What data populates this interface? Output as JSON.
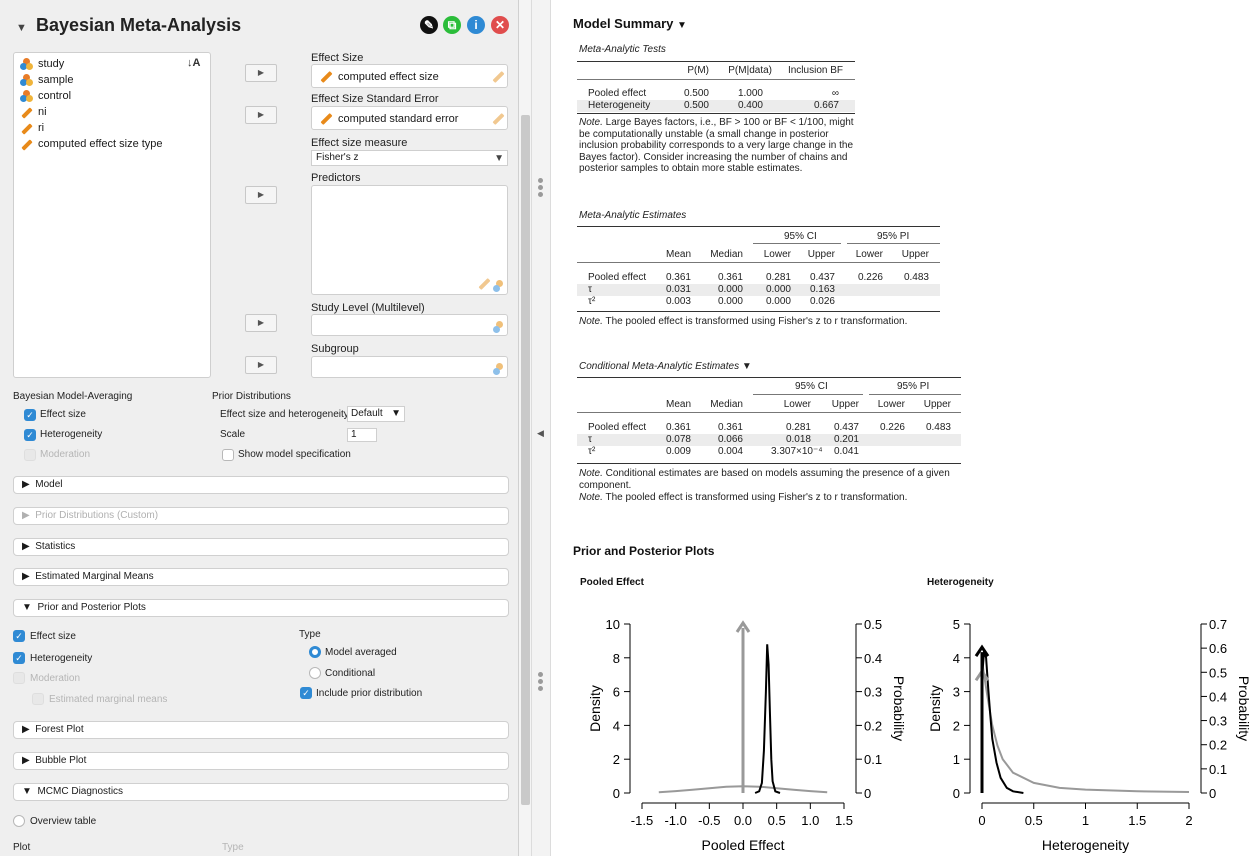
{
  "panel": {
    "title": "Bayesian Meta-Analysis",
    "sort_icon": "sort-az-icon",
    "variables": [
      {
        "name": "study",
        "type": "nominal"
      },
      {
        "name": "sample",
        "type": "nominal"
      },
      {
        "name": "control",
        "type": "nominal"
      },
      {
        "name": "ni",
        "type": "scale"
      },
      {
        "name": "ri",
        "type": "scale"
      },
      {
        "name": "computed effect size type",
        "type": "scale"
      }
    ],
    "effect_size_label": "Effect Size",
    "effect_size_value": "computed effect size",
    "se_label": "Effect Size Standard Error",
    "se_value": "computed standard error",
    "measure_label": "Effect size measure",
    "measure_value": "Fisher's z",
    "predictors_label": "Predictors",
    "study_level_label": "Study Level (Multilevel)",
    "subgroup_label": "Subgroup",
    "bma_label": "Bayesian Model-Averaging",
    "bma_effect_size": "Effect size",
    "bma_heterogeneity": "Heterogeneity",
    "bma_moderation": "Moderation",
    "prior_label": "Prior Distributions",
    "prior_eh_label": "Effect size and heterogeneity",
    "prior_eh_value": "Default",
    "scale_label": "Scale",
    "scale_value": "1",
    "show_model_spec": "Show model specification",
    "sections": [
      "Model",
      "Prior Distributions (Custom)",
      "Statistics",
      "Estimated Marginal Means",
      "Prior and Posterior Plots"
    ],
    "pp_effect_size": "Effect size",
    "pp_heterogeneity": "Heterogeneity",
    "pp_moderation": "Moderation",
    "pp_emm": "Estimated marginal means",
    "type_label": "Type",
    "type_model_averaged": "Model averaged",
    "type_conditional": "Conditional",
    "include_prior": "Include prior distribution",
    "sections2": [
      "Forest Plot",
      "Bubble Plot",
      "MCMC Diagnostics"
    ],
    "overview_table": "Overview table",
    "plot_col": "Plot",
    "type_col": "Type"
  },
  "output": {
    "model_summary": "Model Summary",
    "tests": {
      "title": "Meta-Analytic Tests",
      "headers": [
        "P(M)",
        "P(M|data)",
        "Inclusion BF"
      ],
      "rows": [
        {
          "label": "Pooled effect",
          "pm": "0.500",
          "pmd": "1.000",
          "bf": "∞"
        },
        {
          "label": "Heterogeneity",
          "pm": "0.500",
          "pmd": "0.400",
          "bf": "0.667"
        }
      ],
      "note_prefix": "Note.",
      "note": " Large Bayes factors, i.e., BF > 100 or BF < 1/100, might be computationally unstable (a small change in posterior inclusion probability corresponds to a very large change in the Bayes factor). Consider increasing the number of chains and posterior samples to obtain more stable estimates."
    },
    "estimates": {
      "title": "Meta-Analytic Estimates",
      "ci": "95% CI",
      "pi": "95% PI",
      "headers": [
        "Mean",
        "Median",
        "Lower",
        "Upper",
        "Lower",
        "Upper"
      ],
      "rows": [
        {
          "label": "Pooled effect",
          "cells": [
            "0.361",
            "0.361",
            "0.281",
            "0.437",
            "0.226",
            "0.483"
          ]
        },
        {
          "label": "τ",
          "cells": [
            "0.031",
            "0.000",
            "0.000",
            "0.163",
            "",
            ""
          ]
        },
        {
          "label": "τ²",
          "cells": [
            "0.003",
            "0.000",
            "0.000",
            "0.026",
            "",
            ""
          ]
        }
      ],
      "note_prefix": "Note.",
      "note": " The pooled effect is transformed using Fisher's z to r transformation."
    },
    "conditional": {
      "title": "Conditional Meta-Analytic Estimates",
      "ci": "95% CI",
      "pi": "95% PI",
      "headers": [
        "Mean",
        "Median",
        "Lower",
        "Upper",
        "Lower",
        "Upper"
      ],
      "rows": [
        {
          "label": "Pooled effect",
          "cells": [
            "0.361",
            "0.361",
            "0.281",
            "0.437",
            "0.226",
            "0.483"
          ]
        },
        {
          "label": "τ",
          "cells": [
            "0.078",
            "0.066",
            "0.018",
            "0.201",
            "",
            ""
          ]
        },
        {
          "label": "τ²",
          "cells": [
            "0.009",
            "0.004",
            "3.307×10⁻⁴",
            "0.041",
            "",
            ""
          ]
        }
      ],
      "note1_prefix": "Note.",
      "note1": " Conditional estimates are based on models assuming the presence of a given component.",
      "note2_prefix": "Note.",
      "note2": " The pooled effect is transformed using Fisher's z to r transformation."
    },
    "plots_title": "Prior and Posterior Plots",
    "pooled_title": "Pooled Effect",
    "het_title": "Heterogeneity"
  },
  "chart_data": [
    {
      "type": "line",
      "title": "Pooled Effect",
      "xlabel": "Pooled Effect",
      "ylabel": "Density",
      "y2label": "Probability",
      "xlim": [
        -1.5,
        1.5
      ],
      "xticks": [
        "-1.5",
        "-1.0",
        "-0.5",
        "0.0",
        "0.5",
        "1.0",
        "1.5"
      ],
      "ylim": [
        0,
        10
      ],
      "yticks": [
        "0",
        "2",
        "4",
        "6",
        "8",
        "10"
      ],
      "y2lim": [
        0,
        0.5
      ],
      "y2ticks": [
        "0",
        "0.1",
        "0.2",
        "0.3",
        "0.4",
        "0.5"
      ],
      "series": [
        {
          "color": "#999999",
          "x": [
            -1.25,
            -1.0,
            -0.75,
            -0.5,
            -0.25,
            0.0,
            0.25,
            0.5,
            0.75,
            1.0,
            1.25
          ],
          "y": [
            0.05,
            0.11,
            0.19,
            0.28,
            0.37,
            0.4,
            0.37,
            0.28,
            0.19,
            0.11,
            0.05
          ]
        },
        {
          "color": "#000000",
          "x": [
            0.18,
            0.24,
            0.28,
            0.31,
            0.34,
            0.36,
            0.38,
            0.4,
            0.42,
            0.44,
            0.48,
            0.55
          ],
          "y": [
            0.0,
            0.1,
            0.6,
            2.5,
            6.0,
            8.8,
            7.6,
            4.8,
            2.0,
            0.7,
            0.1,
            0.0
          ]
        }
      ],
      "spikes": [
        {
          "x": 0.0,
          "probability": 0.5,
          "color": "#999999"
        }
      ]
    },
    {
      "type": "line",
      "title": "Heterogeneity",
      "xlabel": "Heterogeneity",
      "ylabel": "Density",
      "y2label": "Probability",
      "xlim": [
        0,
        2
      ],
      "xticks": [
        "0",
        "0.5",
        "1",
        "1.5",
        "2"
      ],
      "ylim": [
        0,
        5
      ],
      "yticks": [
        "0",
        "1",
        "2",
        "3",
        "4",
        "5"
      ],
      "y2lim": [
        0,
        0.7
      ],
      "y2ticks": [
        "0",
        "0.1",
        "0.2",
        "0.3",
        "0.4",
        "0.5",
        "0.6",
        "0.7"
      ],
      "series": [
        {
          "color": "#999999",
          "x": [
            0.0,
            0.05,
            0.1,
            0.15,
            0.2,
            0.3,
            0.5,
            0.75,
            1.0,
            1.5,
            2.0
          ],
          "y": [
            3.9,
            2.9,
            2.0,
            1.4,
            1.0,
            0.6,
            0.3,
            0.15,
            0.1,
            0.05,
            0.03
          ]
        },
        {
          "color": "#000000",
          "x": [
            0.0,
            0.02,
            0.04,
            0.06,
            0.08,
            0.1,
            0.14,
            0.18,
            0.24,
            0.3,
            0.4
          ],
          "y": [
            3.4,
            4.2,
            4.0,
            3.1,
            2.3,
            1.6,
            0.9,
            0.45,
            0.15,
            0.05,
            0.0
          ]
        }
      ],
      "spikes": [
        {
          "x": 0.0,
          "probability": 0.5,
          "color": "#999999"
        },
        {
          "x": 0.0,
          "probability": 0.6,
          "color": "#000000"
        }
      ]
    }
  ],
  "colors": {
    "accent": "#2f8ad4",
    "scale_icon": "#e88a1a",
    "header_bg": "#efefef"
  }
}
